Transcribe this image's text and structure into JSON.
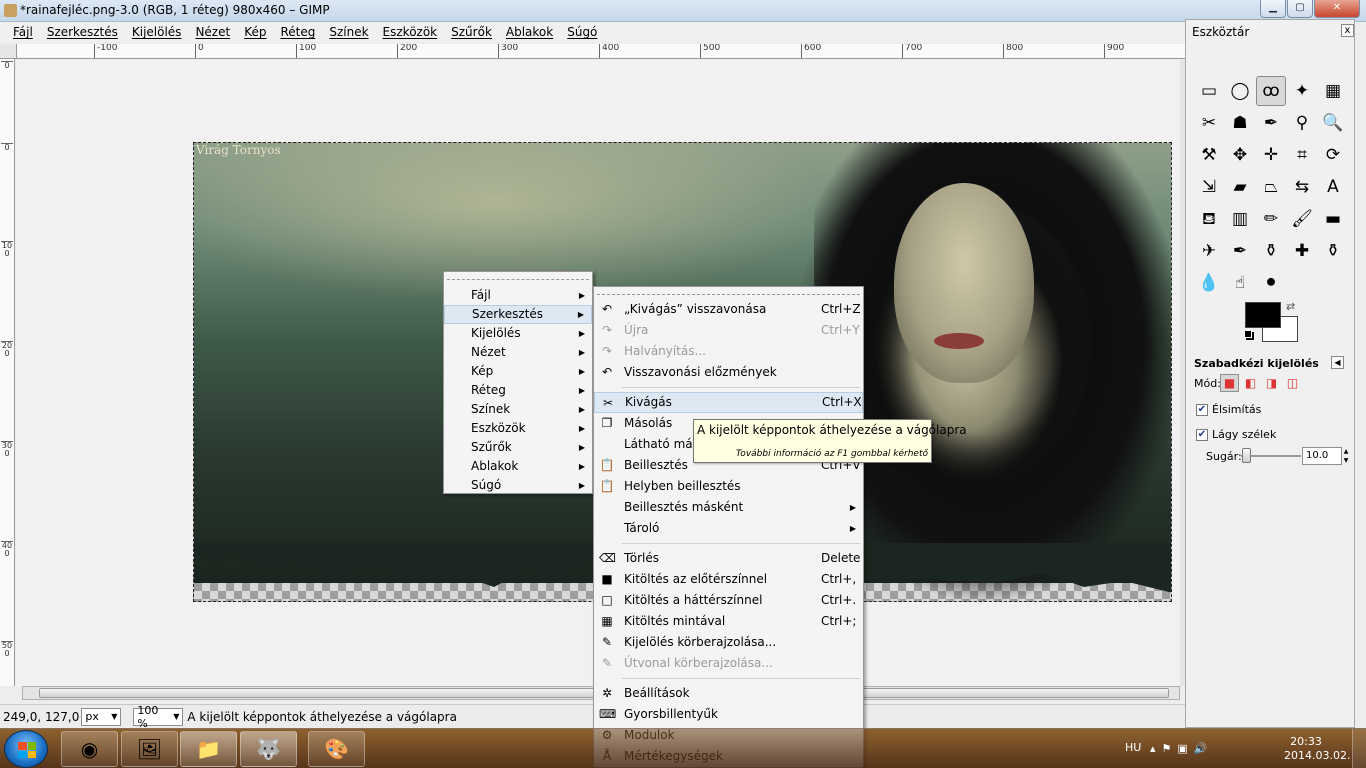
{
  "window": {
    "title": "*rainafejléc.png-3.0 (RGB, 1 réteg) 980x460 – GIMP",
    "min_icon": "minimize-icon",
    "max_icon": "maximize-icon",
    "close_icon": "close-icon",
    "min_glyph": "▁",
    "max_glyph": "▢",
    "close_glyph": "✕"
  },
  "menubar": [
    "Fájl",
    "Szerkesztés",
    "Kijelölés",
    "Nézet",
    "Kép",
    "Réteg",
    "Színek",
    "Eszközök",
    "Szűrők",
    "Ablakok",
    "Súgó"
  ],
  "ruler_top": [
    {
      "label": "-100"
    },
    {
      "label": "0"
    },
    {
      "label": "100"
    },
    {
      "label": "200"
    },
    {
      "label": "300"
    },
    {
      "label": "400"
    },
    {
      "label": "500"
    },
    {
      "label": "600"
    },
    {
      "label": "700"
    },
    {
      "label": "800"
    },
    {
      "label": "900"
    }
  ],
  "ruler_left": [
    "0",
    "0",
    "100",
    "200",
    "300",
    "400",
    "500"
  ],
  "image": {
    "credit": "Virág Tornyos"
  },
  "statusbar": {
    "coords": "249,0, 127,0",
    "unit": "px",
    "zoom": "100 %",
    "message": "A kijelölt képpontok áthelyezése a vágólapra"
  },
  "context_main": {
    "items": [
      {
        "label": "Fájl",
        "highlighted": false
      },
      {
        "label": "Szerkesztés",
        "highlighted": true
      },
      {
        "label": "Kijelölés",
        "highlighted": false
      },
      {
        "label": "Nézet",
        "highlighted": false
      },
      {
        "label": "Kép",
        "highlighted": false
      },
      {
        "label": "Réteg",
        "highlighted": false
      },
      {
        "label": "Színek",
        "highlighted": false
      },
      {
        "label": "Eszközök",
        "highlighted": false
      },
      {
        "label": "Szűrők",
        "highlighted": false
      },
      {
        "label": "Ablakok",
        "highlighted": false
      },
      {
        "label": "Súgó",
        "highlighted": false
      }
    ],
    "submenu_glyph": "▶"
  },
  "context_edit": {
    "groups": [
      [
        {
          "label": "„Kivágás” visszavonása",
          "accel": "Ctrl+Z",
          "icon": "undo-icon",
          "glyph": "↶",
          "disabled": false
        },
        {
          "label": "Újra",
          "accel": "Ctrl+Y",
          "icon": "redo-icon",
          "glyph": "↷",
          "disabled": true
        },
        {
          "label": "Halványítás...",
          "accel": "",
          "icon": "fade-icon",
          "glyph": "↷",
          "disabled": true
        },
        {
          "label": "Visszavonási előzmények",
          "accel": "",
          "icon": "history-icon",
          "glyph": "↶",
          "disabled": false
        }
      ],
      [
        {
          "label": "Kivágás",
          "accel": "Ctrl+X",
          "icon": "cut-icon",
          "glyph": "✂",
          "disabled": false,
          "highlighted": true
        },
        {
          "label": "Másolás",
          "accel": "",
          "icon": "copy-icon",
          "glyph": "❐",
          "disabled": false
        },
        {
          "label": "Látható másolása",
          "accel": "",
          "icon": "",
          "glyph": "",
          "disabled": false
        },
        {
          "label": "Beillesztés",
          "accel": "Ctrl+V",
          "icon": "paste-icon",
          "glyph": "📋",
          "disabled": false
        },
        {
          "label": "Helyben beillesztés",
          "accel": "",
          "icon": "paste-in-place-icon",
          "glyph": "📋",
          "disabled": false
        },
        {
          "label": "Beillesztés másként",
          "accel": "",
          "icon": "",
          "glyph": "",
          "disabled": false,
          "submenu": true
        },
        {
          "label": "Tároló",
          "accel": "",
          "icon": "",
          "glyph": "",
          "disabled": false,
          "submenu": true
        }
      ],
      [
        {
          "label": "Törlés",
          "accel": "Delete",
          "icon": "clear-icon",
          "glyph": "⌫",
          "disabled": false
        },
        {
          "label": "Kitöltés az előtérszínnel",
          "accel": "Ctrl+,",
          "icon": "fill-fg-icon",
          "glyph": "■",
          "disabled": false
        },
        {
          "label": "Kitöltés a háttérszínnel",
          "accel": "Ctrl+.",
          "icon": "fill-bg-icon",
          "glyph": "□",
          "disabled": false
        },
        {
          "label": "Kitöltés mintával",
          "accel": "Ctrl+;",
          "icon": "fill-pattern-icon",
          "glyph": "▦",
          "disabled": false
        },
        {
          "label": "Kijelölés körberajzolása...",
          "accel": "",
          "icon": "stroke-selection-icon",
          "glyph": "✎",
          "disabled": false
        },
        {
          "label": "Útvonal körberajzolása...",
          "accel": "",
          "icon": "stroke-path-icon",
          "glyph": "✎",
          "disabled": true
        }
      ],
      [
        {
          "label": "Beállítások",
          "accel": "",
          "icon": "preferences-icon",
          "glyph": "✲",
          "disabled": false
        },
        {
          "label": "Gyorsbillentyűk",
          "accel": "",
          "icon": "keyboard-icon",
          "glyph": "⌨",
          "disabled": false
        },
        {
          "label": "Modulok",
          "accel": "",
          "icon": "modules-icon",
          "glyph": "⚙",
          "disabled": false
        },
        {
          "label": "Mértékegységek",
          "accel": "",
          "icon": "units-icon",
          "glyph": "Å",
          "disabled": false
        }
      ]
    ],
    "submenu_glyph": "▶"
  },
  "tooltip": {
    "text": "A kijelölt képpontok áthelyezése a vágólapra",
    "hint": "További információ az F1 gombbal kérhető"
  },
  "toolbox": {
    "title": "Eszköztár",
    "close": "x",
    "tools": [
      {
        "name": "rect-select-icon",
        "glyph": "▭"
      },
      {
        "name": "ellipse-select-icon",
        "glyph": "◯"
      },
      {
        "name": "free-select-icon",
        "glyph": "ꝏ",
        "active": true
      },
      {
        "name": "fuzzy-select-icon",
        "glyph": "✦"
      },
      {
        "name": "color-select-icon",
        "glyph": "▦"
      },
      {
        "name": "scissors-select-icon",
        "glyph": "✂"
      },
      {
        "name": "foreground-select-icon",
        "glyph": "☗"
      },
      {
        "name": "paths-icon",
        "glyph": "✒"
      },
      {
        "name": "color-picker-icon",
        "glyph": "⚲"
      },
      {
        "name": "zoom-icon",
        "glyph": "🔍"
      },
      {
        "name": "measure-icon",
        "glyph": "⚒"
      },
      {
        "name": "move-icon",
        "glyph": "✥"
      },
      {
        "name": "align-icon",
        "glyph": "✛"
      },
      {
        "name": "crop-icon",
        "glyph": "⌗"
      },
      {
        "name": "rotate-icon",
        "glyph": "⟳"
      },
      {
        "name": "scale-icon",
        "glyph": "⇲"
      },
      {
        "name": "shear-icon",
        "glyph": "▰"
      },
      {
        "name": "perspective-icon",
        "glyph": "⏢"
      },
      {
        "name": "flip-icon",
        "glyph": "⇆"
      },
      {
        "name": "text-icon",
        "glyph": "A"
      },
      {
        "name": "bucket-fill-icon",
        "glyph": "⛾"
      },
      {
        "name": "blend-icon",
        "glyph": "▥"
      },
      {
        "name": "pencil-icon",
        "glyph": "✏"
      },
      {
        "name": "paintbrush-icon",
        "glyph": "🖌"
      },
      {
        "name": "eraser-icon",
        "glyph": "▬"
      },
      {
        "name": "airbrush-icon",
        "glyph": "✈"
      },
      {
        "name": "ink-icon",
        "glyph": "✒"
      },
      {
        "name": "clone-icon",
        "glyph": "⚱"
      },
      {
        "name": "heal-icon",
        "glyph": "✚"
      },
      {
        "name": "perspective-clone-icon",
        "glyph": "⚱"
      },
      {
        "name": "blur-icon",
        "glyph": "💧"
      },
      {
        "name": "smudge-icon",
        "glyph": "☝"
      },
      {
        "name": "dodge-burn-icon",
        "glyph": "⚫"
      }
    ]
  },
  "tool_options": {
    "title": "Szabadkézi kijelölés",
    "menu_glyph": "◀",
    "mode_label": "Mód:",
    "antialias": "Élsimítás",
    "feather": "Lágy szélek",
    "radius_label": "Sugár:",
    "radius_value": "10.0",
    "radius_fraction": 0.0,
    "check_glyph": "✔"
  },
  "taskbar": {
    "lang": "HU",
    "time": "20:33",
    "date": "2014.03.02.",
    "apps": [
      {
        "name": "chrome-icon",
        "glyph": "◉"
      },
      {
        "name": "photo-viewer-icon",
        "glyph": "🖼"
      },
      {
        "name": "explorer-icon",
        "glyph": "📁",
        "active": true
      },
      {
        "name": "gimp-icon",
        "glyph": "🐺",
        "active": true
      },
      {
        "name": "paint-icon",
        "glyph": "🎨"
      }
    ],
    "tray": [
      "▴",
      "⚑",
      "▣",
      "🔊"
    ]
  },
  "colors": {
    "menu_highlight": "#dde8f3",
    "tooltip_bg": "#ffffe1",
    "foreground": "#000000",
    "background": "#ffffff"
  }
}
